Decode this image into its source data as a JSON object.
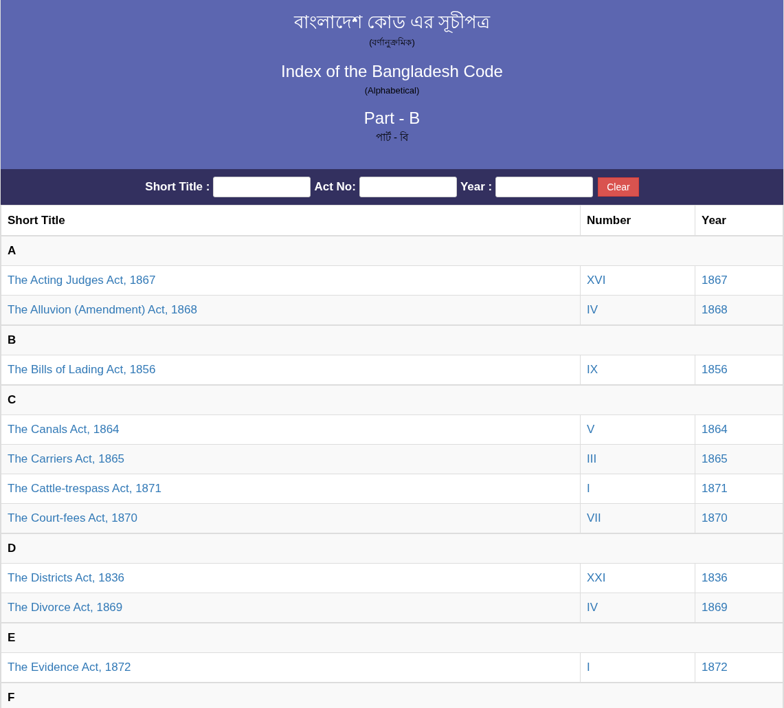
{
  "header": {
    "title_bn": "বাংলাদেশ কোড এর সূচীপত্র",
    "subtitle_bn": "(বর্ণানুক্রমিক)",
    "title_en": "Index of the Bangladesh Code",
    "subtitle_en": "(Alphabetical)",
    "part_en": "Part - B",
    "part_bn": "পার্ট - বি"
  },
  "filters": {
    "fields": [
      {
        "label": "Short Title :"
      },
      {
        "label": "Act No:"
      },
      {
        "label": "Year :"
      }
    ],
    "clear_button": "Clear"
  },
  "table": {
    "columns": [
      "Short Title",
      "Number",
      "Year"
    ],
    "groups": [
      {
        "letter": "A",
        "rows": [
          [
            "The Acting Judges Act, 1867",
            "XVI",
            "1867"
          ],
          [
            "The Alluvion (Amendment) Act, 1868",
            "IV",
            "1868"
          ]
        ]
      },
      {
        "letter": "B",
        "rows": [
          [
            "The Bills of Lading Act, 1856",
            "IX",
            "1856"
          ]
        ]
      },
      {
        "letter": "C",
        "rows": [
          [
            "The Canals Act, 1864",
            "V",
            "1864"
          ],
          [
            "The Carriers Act, 1865",
            "III",
            "1865"
          ],
          [
            "The Cattle-trespass Act, 1871",
            "I",
            "1871"
          ],
          [
            "The Court-fees Act, 1870",
            "VII",
            "1870"
          ]
        ]
      },
      {
        "letter": "D",
        "rows": [
          [
            "The Districts Act, 1836",
            "XXI",
            "1836"
          ],
          [
            "The Divorce Act, 1869",
            "IV",
            "1869"
          ]
        ]
      },
      {
        "letter": "E",
        "rows": [
          [
            "The Evidence Act, 1872",
            "I",
            "1872"
          ]
        ]
      },
      {
        "letter": "F"
      }
    ]
  }
}
